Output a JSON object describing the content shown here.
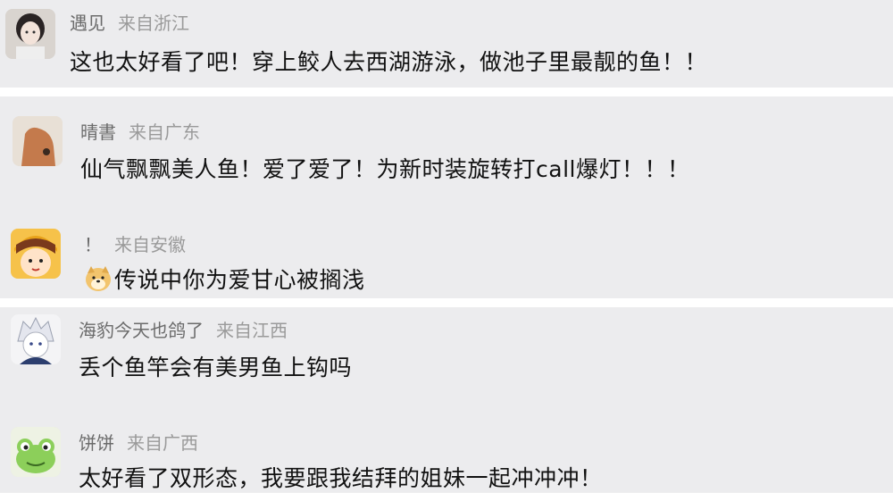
{
  "comments": [
    {
      "name": "遇见",
      "location": "来自浙江",
      "text": "这也太好看了吧！穿上鲛人去西湖游泳，做池子里最靓的鱼！！",
      "avatar_icon": "girl-portrait-avatar"
    },
    {
      "name": "晴書",
      "location": "来自广东",
      "text": "仙气飘飘美人鱼！爱了爱了！为新时装旋转打call爆灯！！！",
      "avatar_icon": "cat-ear-avatar"
    },
    {
      "name": "！",
      "location": "来自安徽",
      "text": "传说中你为爱甘心被搁浅",
      "avatar_icon": "cartoon-girl-avatar",
      "emoji_icon": "doge-emoji-icon"
    },
    {
      "name": "海豹今天也鸽了",
      "location": "来自江西",
      "text": "丢个鱼竿会有美男鱼上钩吗",
      "avatar_icon": "anime-boy-avatar"
    },
    {
      "name": "饼饼",
      "location": "来自广西",
      "text": "太好看了双形态，我要跟我结拜的姐妹一起冲冲冲！",
      "avatar_icon": "green-frog-avatar"
    }
  ]
}
